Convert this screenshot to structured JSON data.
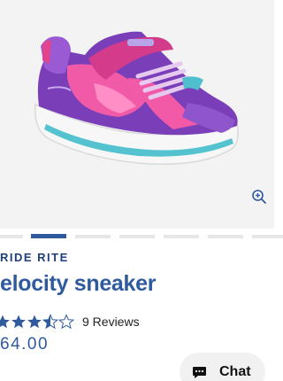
{
  "product": {
    "brand": "RIDE RITE",
    "name": "elocity sneaker",
    "rating_value": 3.5,
    "rating_max": 5,
    "reviews_label": "9 Reviews",
    "price": "64.00"
  },
  "gallery": {
    "image_count": 7,
    "active_index": 0,
    "zoom_icon": "zoom-in-icon"
  },
  "chat": {
    "label": "Chat",
    "icon": "chat-bubble-icon"
  },
  "colors": {
    "brand_blue": "#2f5a9e",
    "dark_blue": "#1f3f7a",
    "star_fill": "#2f5a9e"
  }
}
